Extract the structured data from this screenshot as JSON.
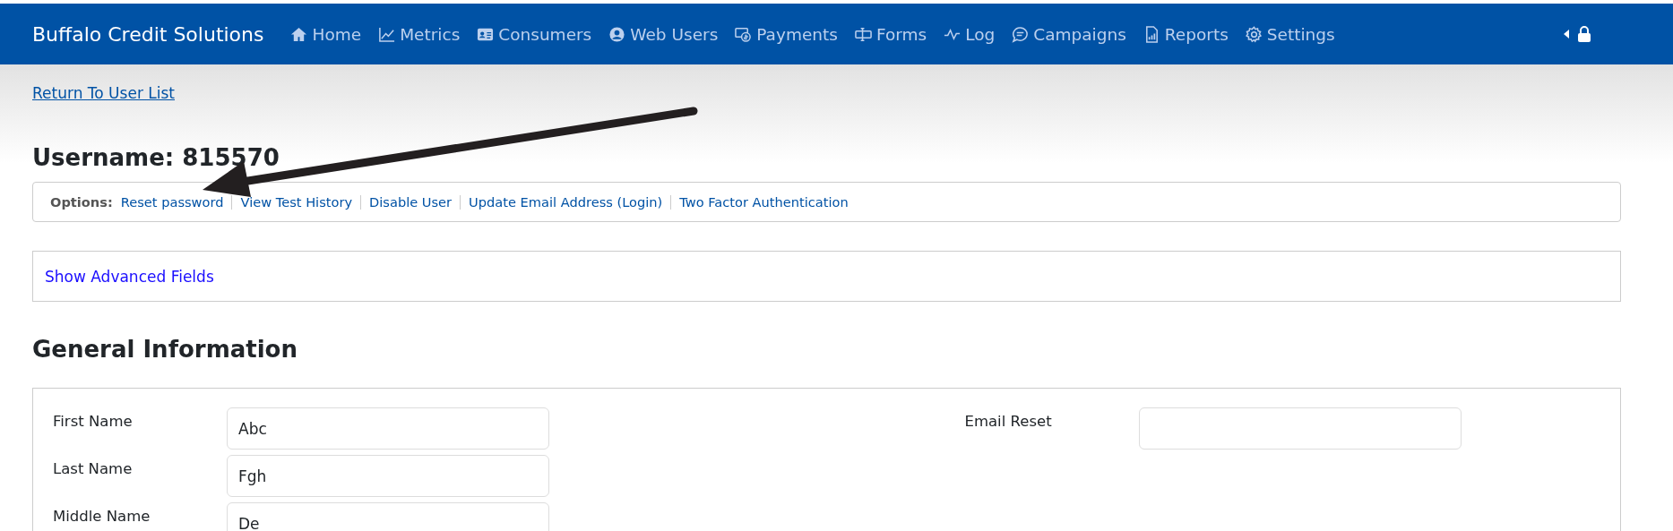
{
  "navbar": {
    "brand": "Buffalo Credit Solutions",
    "items": [
      {
        "label": "Home"
      },
      {
        "label": "Metrics"
      },
      {
        "label": "Consumers"
      },
      {
        "label": "Web Users"
      },
      {
        "label": "Payments"
      },
      {
        "label": "Forms"
      },
      {
        "label": "Log"
      },
      {
        "label": "Campaigns"
      },
      {
        "label": "Reports"
      },
      {
        "label": "Settings"
      }
    ]
  },
  "back_link": "Return To User List",
  "heading": "Username: 815570",
  "options": {
    "label": "Options:",
    "links": [
      "Reset password",
      "View Test History",
      "Disable User",
      "Update Email Address (Login)",
      "Two Factor Authentication"
    ]
  },
  "advanced_toggle": "Show Advanced Fields",
  "section_title": "General Information",
  "form": {
    "left": [
      {
        "label": "First Name",
        "value": "Abc"
      },
      {
        "label": "Last Name",
        "value": "Fgh"
      },
      {
        "label": "Middle Name",
        "value": "De"
      }
    ],
    "right": [
      {
        "label": "Email Reset"
      }
    ]
  }
}
